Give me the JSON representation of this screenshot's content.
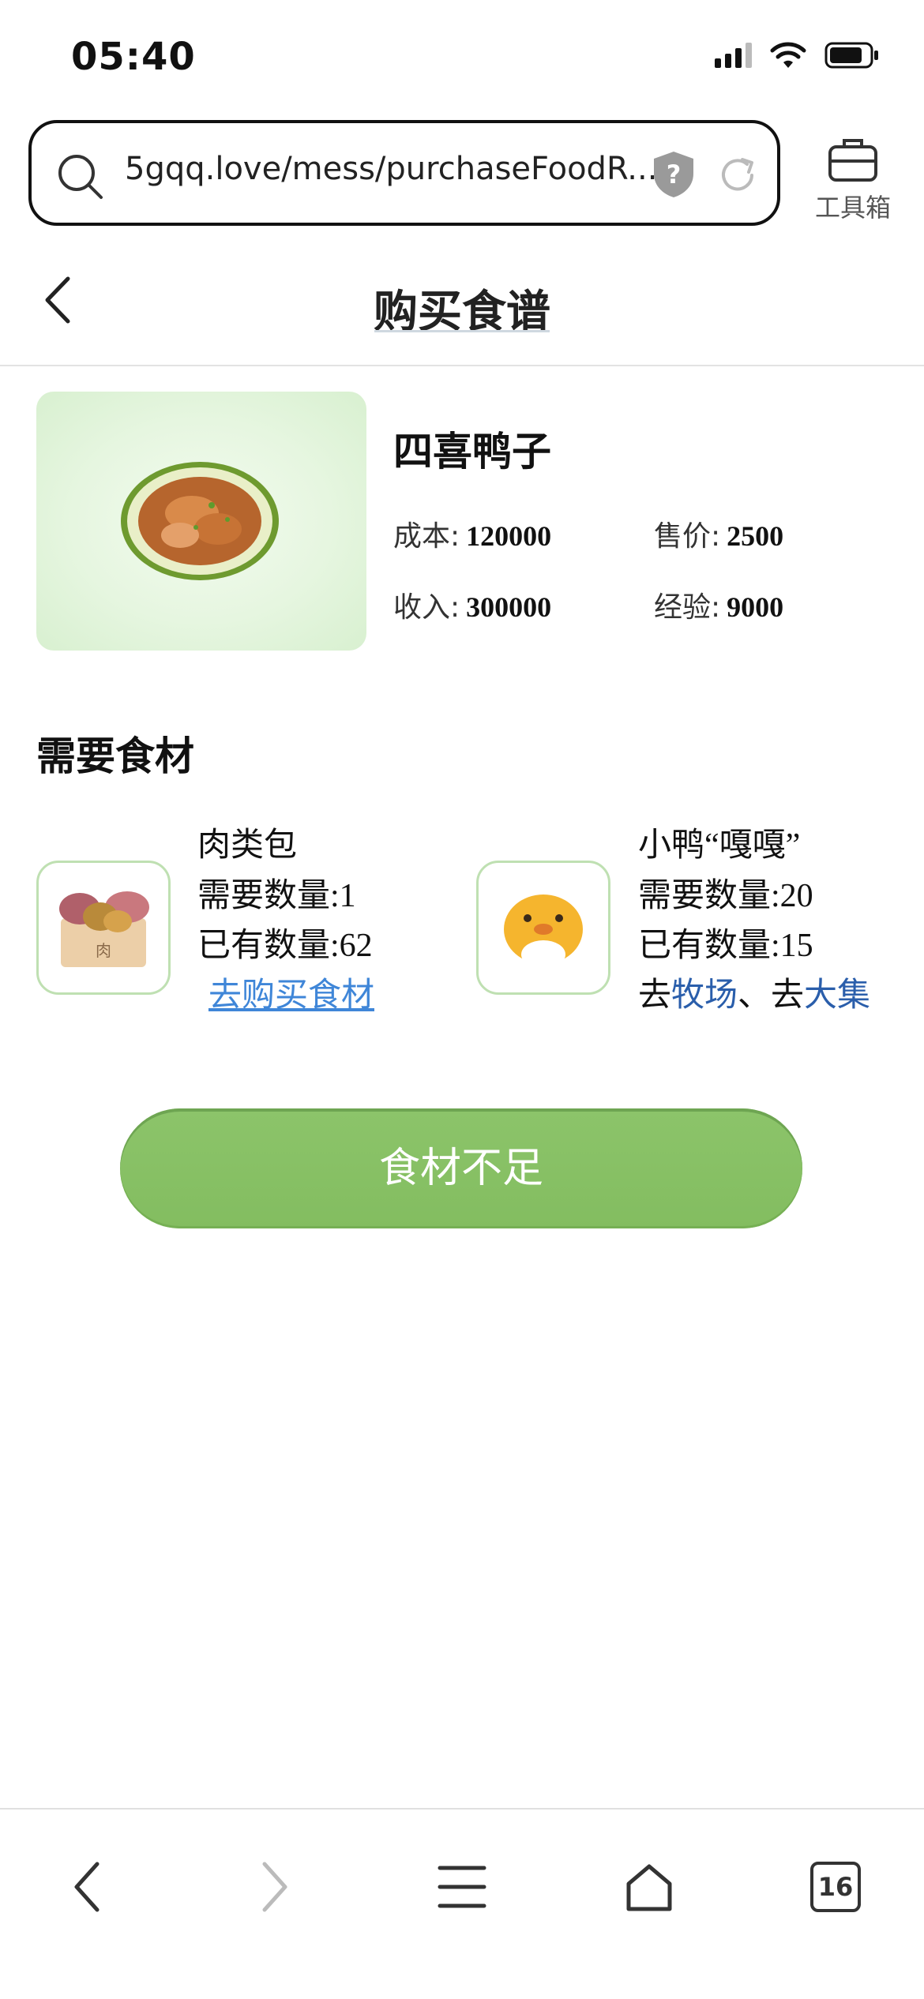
{
  "status_bar": {
    "time": "05:40"
  },
  "browser": {
    "url": "5gqq.love/mess/purchaseFoodR...",
    "toolbox_label": "工具箱",
    "tab_count": "16"
  },
  "header": {
    "title": "购买食谱"
  },
  "food": {
    "name": "四喜鸭子",
    "stats": [
      {
        "label": "成本:",
        "value": "120000"
      },
      {
        "label": "售价:",
        "value": "2500"
      },
      {
        "label": "收入:",
        "value": "300000"
      },
      {
        "label": "经验:",
        "value": "9000"
      }
    ]
  },
  "ingredients": {
    "title": "需要食材",
    "items": [
      {
        "name": "肉类包",
        "required": "需要数量:1",
        "owned": "已有数量:62",
        "action": "去购买食材",
        "box_label": "肉"
      },
      {
        "name": "小鸭“嘎嘎”",
        "required": "需要数量:20",
        "owned": "已有数量:15",
        "action_prefix": "去",
        "action_link1": "牧场",
        "action_sep": "、去",
        "action_link2": "大集"
      }
    ]
  },
  "primary_button": {
    "label": "食材不足"
  },
  "colors": {
    "accent_green": "#86c063",
    "link_blue": "#3f86d8",
    "link_navy": "#2a5eab"
  }
}
